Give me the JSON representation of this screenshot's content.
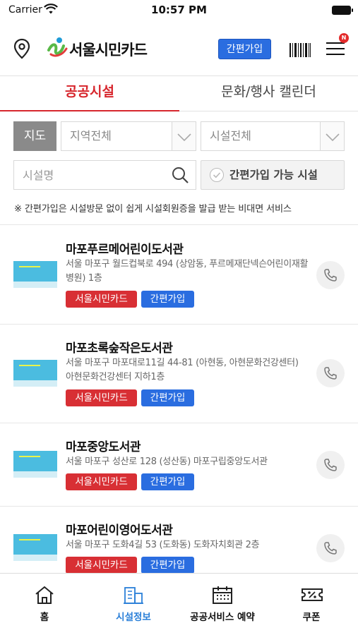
{
  "status_bar": {
    "carrier": "Carrier",
    "time": "10:57 PM"
  },
  "header": {
    "logo_text": "서울시민카드",
    "join_button": "간편가입",
    "menu_badge": "N"
  },
  "tabs": [
    {
      "label": "공공시설",
      "active": true
    },
    {
      "label": "문화/행사 캘린더",
      "active": false
    }
  ],
  "filters": {
    "map_button": "지도",
    "region_select": "지역전체",
    "facility_select": "시설전체",
    "search_placeholder": "시설명",
    "easy_join_filter": "간편가입 가능 시설"
  },
  "notice": "※ 간편가입은 시설방문 없이 쉽게 시설회원증을 발급 받는 비대면 서비스",
  "facilities": [
    {
      "name": "마포푸르메어린이도서관",
      "address": "서울 마포구 월드컵북로 494 (상암동, 푸르메재단넥슨어린이재활병원) 1층",
      "tags": [
        "서울시민카드",
        "간편가입"
      ]
    },
    {
      "name": "마포초록숲작은도서관",
      "address": "서울 마포구 마포대로11길 44-81 (아현동, 아현문화건강센터) 아현문화건강센터 지하1층",
      "tags": [
        "서울시민카드",
        "간편가입"
      ]
    },
    {
      "name": "마포중앙도서관",
      "address": "서울 마포구 성산로 128 (성산동) 마포구립중앙도서관",
      "tags": [
        "서울시민카드",
        "간편가입"
      ]
    },
    {
      "name": "마포어린이영어도서관",
      "address": "서울 마포구 도화4길 53 (도화동) 도화자치회관 2층",
      "tags": [
        "서울시민카드",
        "간편가입"
      ]
    }
  ],
  "bottom_nav": [
    {
      "label": "홈",
      "icon": "home-icon",
      "active": false
    },
    {
      "label": "시설정보",
      "icon": "building-icon",
      "active": true
    },
    {
      "label": "공공서비스 예약",
      "icon": "calendar-icon",
      "active": false
    },
    {
      "label": "쿠폰",
      "icon": "coupon-icon",
      "active": false
    }
  ],
  "colors": {
    "accent_red": "#d7262d",
    "accent_blue": "#2a6de0",
    "nav_active": "#2a7fd8"
  }
}
